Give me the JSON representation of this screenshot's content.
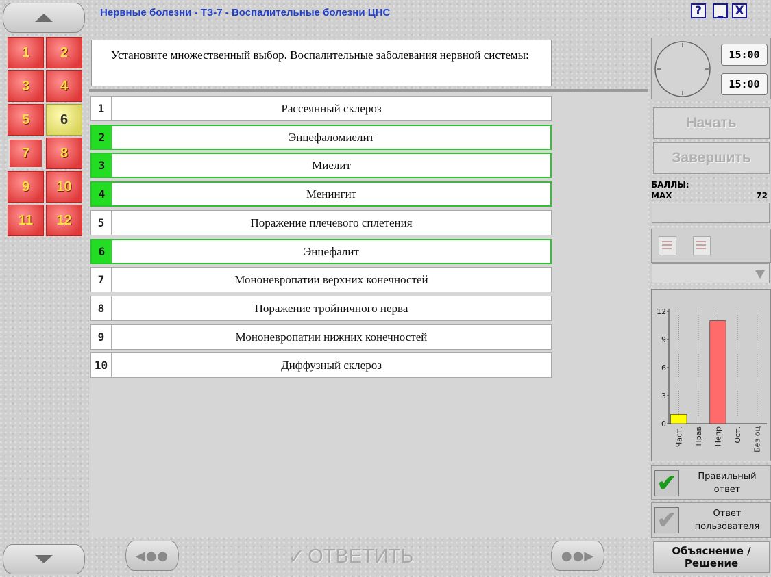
{
  "window": {
    "title": "Нервные болезни - ТЗ-7 - Воспалительные болезни ЦНС",
    "help_label": "?",
    "minimize_label": "_",
    "close_label": "X"
  },
  "question_nav": [
    {
      "label": "1",
      "state": "answered"
    },
    {
      "label": "2",
      "state": "answered"
    },
    {
      "label": "3",
      "state": "answered"
    },
    {
      "label": "4",
      "state": "answered"
    },
    {
      "label": "5",
      "state": "answered"
    },
    {
      "label": "6",
      "state": "current"
    },
    {
      "label": "7",
      "state": "selected"
    },
    {
      "label": "8",
      "state": "answered"
    },
    {
      "label": "9",
      "state": "answered"
    },
    {
      "label": "10",
      "state": "answered"
    },
    {
      "label": "11",
      "state": "answered"
    },
    {
      "label": "12",
      "state": "answered"
    }
  ],
  "question": {
    "text": "Установите множественный выбор. Воспалительные заболевания нервной системы:"
  },
  "answers": [
    {
      "num": "1",
      "text": "Рассеянный склероз",
      "selected": false
    },
    {
      "num": "2",
      "text": "Энцефаломиелит",
      "selected": true
    },
    {
      "num": "3",
      "text": "Миелит",
      "selected": true
    },
    {
      "num": "4",
      "text": "Менингит",
      "selected": true
    },
    {
      "num": "5",
      "text": "Поражение плечевого сплетения",
      "selected": false
    },
    {
      "num": "6",
      "text": "Энцефалит",
      "selected": true
    },
    {
      "num": "7",
      "text": "Мононевропатии верхних конечностей",
      "selected": false
    },
    {
      "num": "8",
      "text": "Поражение тройничного нерва",
      "selected": false
    },
    {
      "num": "9",
      "text": "Мононевропатии нижних конечностей",
      "selected": false
    },
    {
      "num": "10",
      "text": "Диффузный склероз",
      "selected": false
    }
  ],
  "bottom": {
    "prev_label": "◀●●",
    "next_label": "●●▶",
    "answer_label": "ОТВЕТИТЬ",
    "answer_check": "✓"
  },
  "timer": {
    "total": "15:00",
    "remaining": "15:00"
  },
  "controls": {
    "start_label": "Начать",
    "finish_label": "Завершить"
  },
  "score": {
    "label": "БАЛЛЫ:",
    "max_label": "MAX",
    "max_value": "72"
  },
  "chart_data": {
    "type": "bar",
    "categories": [
      "Част.",
      "Прав",
      "Непр",
      "Ост.",
      "Без оц"
    ],
    "values": [
      1,
      0,
      11,
      0,
      0
    ],
    "colors": [
      "#ffff00",
      "#00cc00",
      "#ff6a6a",
      "#999999",
      "#999999"
    ],
    "yticks": [
      "0",
      "3",
      "6",
      "9",
      "12"
    ],
    "ylim": [
      0,
      12
    ]
  },
  "legend": {
    "correct_label": "Правильный ответ",
    "user_label": "Ответ пользователя",
    "correct_icon": "✔",
    "user_icon": "✔"
  },
  "explain": {
    "label_line1": "Объяснение /",
    "label_line2": "Решение"
  }
}
